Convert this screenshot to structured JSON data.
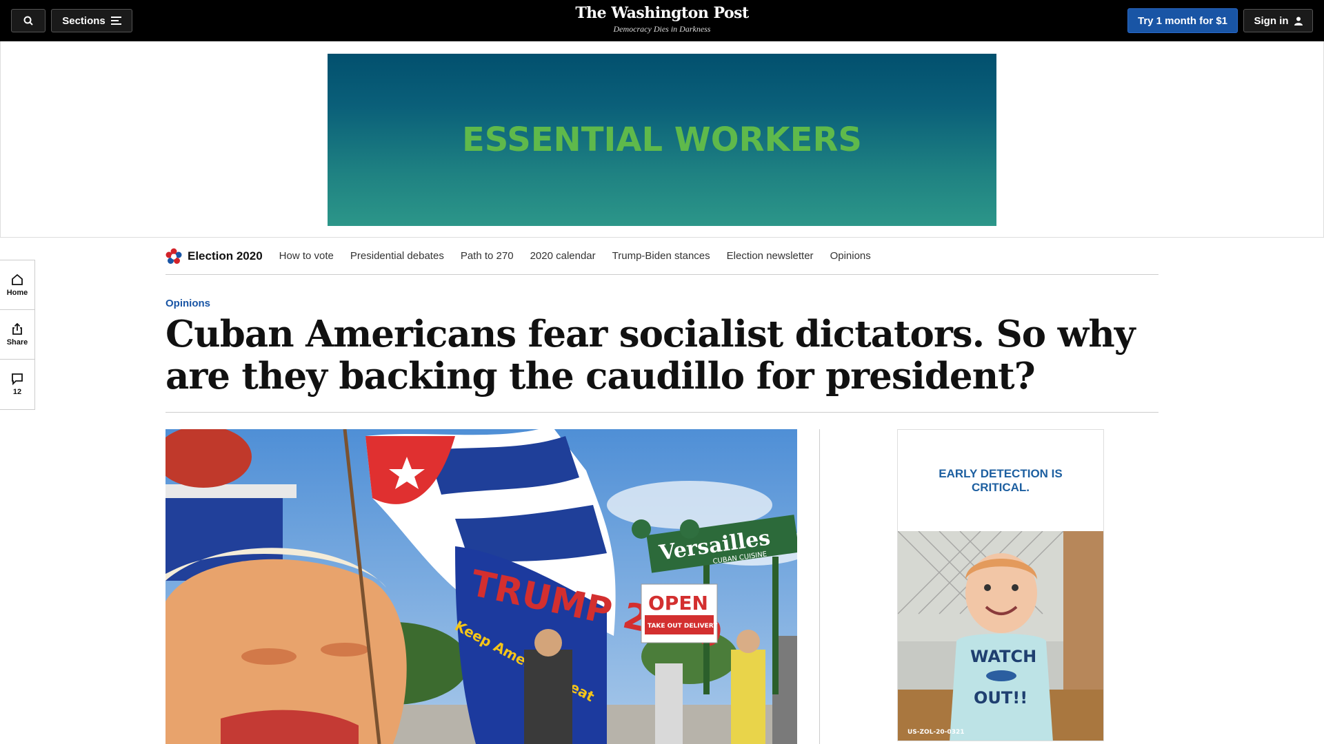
{
  "header": {
    "sections_label": "Sections",
    "logo": "The Washington Post",
    "tagline": "Democracy Dies in Darkness",
    "subscribe_label": "Try 1 month for $1",
    "signin_label": "Sign in"
  },
  "banner_ad": {
    "headline": "ESSENTIAL WORKERS"
  },
  "election_nav": {
    "brand": "Election 2020",
    "links": [
      "How to vote",
      "Presidential debates",
      "Path to 270",
      "2020 calendar",
      "Trump-Biden stances",
      "Election newsletter",
      "Opinions"
    ]
  },
  "rail": {
    "home_label": "Home",
    "share_label": "Share",
    "comments_count": "12"
  },
  "article": {
    "kicker": "Opinions",
    "headline": "Cuban Americans fear socialist dictators. So why are they backing the caudillo for president?"
  },
  "photo": {
    "sign_brand": "Versailles",
    "sign_subtitle": "CUBAN CUISINE",
    "open_text": "OPEN",
    "takeout_text": "TAKE OUT DELIVERY",
    "flag_text": "TRUMP 2020",
    "flag_slogan": "Keep America Great"
  },
  "side_ad": {
    "headline": "EARLY DETECTION IS CRITICAL.",
    "shirt_text_top": "WATCH",
    "shirt_text_bottom": "OUT!!",
    "code": "US-ZOL-20-0321"
  }
}
